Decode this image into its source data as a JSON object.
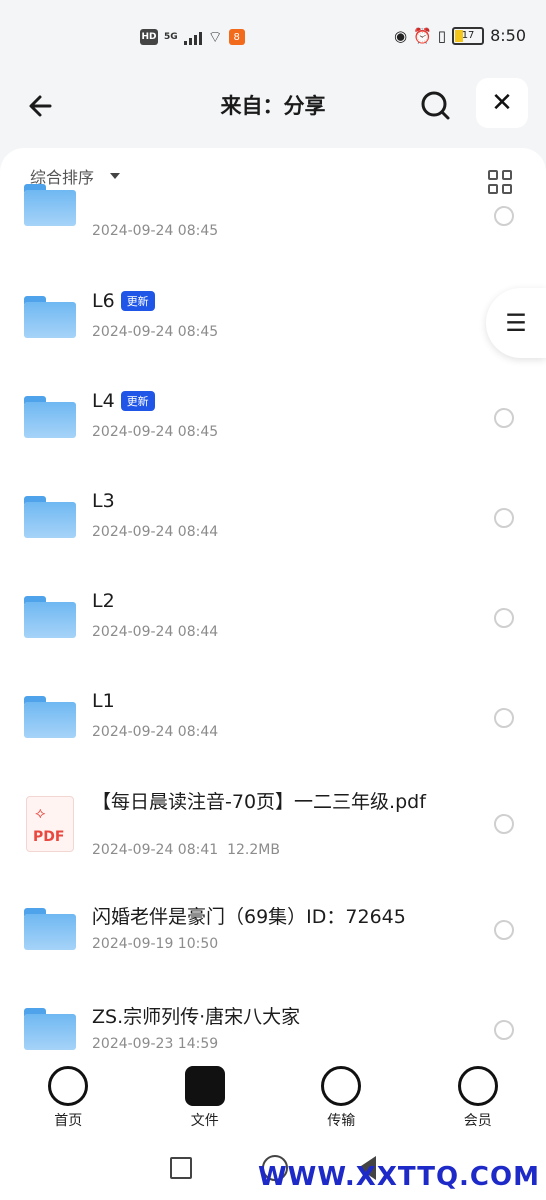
{
  "status_bar": {
    "time": "8:50",
    "battery": "17",
    "net": "5G",
    "hd": "HD"
  },
  "header": {
    "title": "来自：分享"
  },
  "sort": {
    "label": "综合排序"
  },
  "rows": [
    {
      "name": "",
      "date": "2024-09-24 08:45",
      "type": "folder",
      "badge": ""
    },
    {
      "name": "L6",
      "date": "2024-09-24 08:45",
      "type": "folder",
      "badge": "更新"
    },
    {
      "name": "L4",
      "date": "2024-09-24 08:45",
      "type": "folder",
      "badge": "更新"
    },
    {
      "name": "L3",
      "date": "2024-09-24 08:44",
      "type": "folder",
      "badge": ""
    },
    {
      "name": "L2",
      "date": "2024-09-24 08:44",
      "type": "folder",
      "badge": ""
    },
    {
      "name": "L1",
      "date": "2024-09-24 08:44",
      "type": "folder",
      "badge": ""
    },
    {
      "name": "【每日晨读注音-70页】一二三年级.pdf",
      "date": "2024-09-24 08:41",
      "size": "12.2MB",
      "type": "pdf",
      "badge": ""
    },
    {
      "name": "闪婚老伴是豪门（69集）ID：72645",
      "date": "2024-09-19 10:50",
      "type": "folder",
      "badge": ""
    },
    {
      "name": "ZS.宗师列传·唐宋八大家",
      "date": "2024-09-23 14:59",
      "type": "folder",
      "badge": ""
    }
  ],
  "tabs": [
    "首页",
    "文件",
    "传输",
    "会员"
  ],
  "watermark": "WWW.XXTTQ.COM",
  "pdf_label": "PDF"
}
